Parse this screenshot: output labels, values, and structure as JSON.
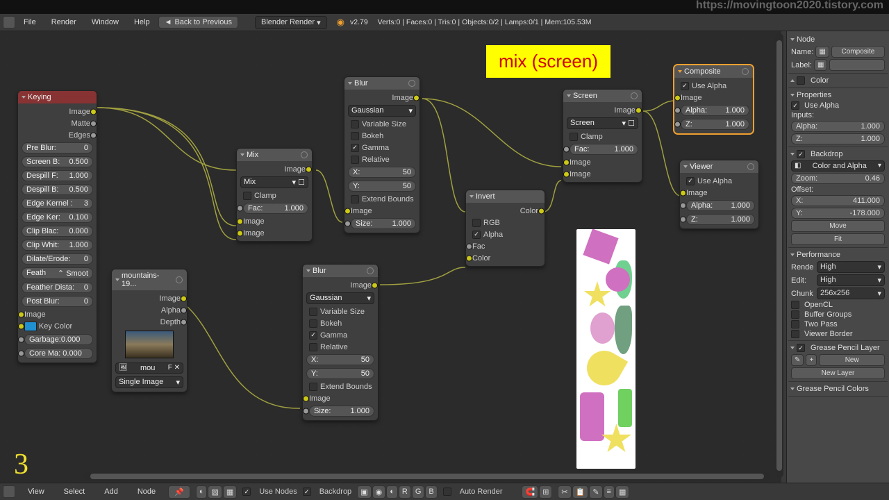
{
  "watermark": "https://movingtoon2020.tistory.com",
  "menus": {
    "file": "File",
    "render": "Render",
    "window": "Window",
    "help": "Help",
    "back": "Back to Previous",
    "engine": "Blender Render"
  },
  "version": "v2.79",
  "stats": "Verts:0 | Faces:0 | Tris:0 | Objects:0/2 | Lamps:0/1 | Mem:105.53M",
  "annot": {
    "label": "mix (screen)",
    "num": "3"
  },
  "nodes": {
    "keying": {
      "title": "Keying",
      "outs": [
        "Image",
        "Matte",
        "Edges"
      ],
      "sliders": [
        {
          "l": "Pre Blur:",
          "v": "0"
        },
        {
          "l": "Screen B:",
          "v": "0.500"
        },
        {
          "l": "Despill F:",
          "v": "1.000"
        },
        {
          "l": "Despill B:",
          "v": "0.500"
        },
        {
          "l": "Edge Kernel :",
          "v": "3"
        },
        {
          "l": "Edge Ker:",
          "v": "0.100"
        },
        {
          "l": "Clip Blac:",
          "v": "0.000"
        },
        {
          "l": "Clip Whit:",
          "v": "1.000"
        },
        {
          "l": "Dilate/Erode:",
          "v": "0"
        },
        {
          "l": "Feath",
          "v": "Smoot"
        },
        {
          "l": "Feather Dista:",
          "v": "0"
        },
        {
          "l": "Post Blur:",
          "v": "0"
        }
      ],
      "ins": [
        "Image",
        "Key Color",
        "Garbage:0.000",
        "Core Ma: 0.000"
      ]
    },
    "mountains": {
      "title": "mountains-19...",
      "outs": [
        "Image",
        "Alpha",
        "Depth"
      ],
      "file": "mou",
      "mode": "Single Image"
    },
    "mix": {
      "title": "Mix",
      "out": "Image",
      "type": "Mix",
      "clamp": "Clamp",
      "fac": {
        "l": "Fac:",
        "v": "1.000"
      },
      "ins": [
        "Image",
        "Image"
      ]
    },
    "blur1": {
      "title": "Blur",
      "out": "Image",
      "type": "Gaussian",
      "checks": [
        {
          "l": "Variable Size",
          "on": false
        },
        {
          "l": "Bokeh",
          "on": false
        },
        {
          "l": "Gamma",
          "on": true
        },
        {
          "l": "Relative",
          "on": false
        }
      ],
      "x": {
        "l": "X:",
        "v": "50"
      },
      "y": {
        "l": "Y:",
        "v": "50"
      },
      "ext": "Extend Bounds",
      "in": "Image",
      "size": {
        "l": "Size:",
        "v": "1.000"
      }
    },
    "blur2": {
      "title": "Blur",
      "out": "Image",
      "type": "Gaussian",
      "checks": [
        {
          "l": "Variable Size",
          "on": false
        },
        {
          "l": "Bokeh",
          "on": false
        },
        {
          "l": "Gamma",
          "on": true
        },
        {
          "l": "Relative",
          "on": false
        }
      ],
      "x": {
        "l": "X:",
        "v": "50"
      },
      "y": {
        "l": "Y:",
        "v": "50"
      },
      "ext": "Extend Bounds",
      "in": "Image",
      "size": {
        "l": "Size:",
        "v": "1.000"
      }
    },
    "invert": {
      "title": "Invert",
      "out": "Color",
      "rgb": "RGB",
      "alpha": "Alpha",
      "ins": [
        "Fac",
        "Color"
      ]
    },
    "screen": {
      "title": "Screen",
      "out": "Image",
      "type": "Screen",
      "clamp": "Clamp",
      "fac": {
        "l": "Fac:",
        "v": "1.000"
      },
      "ins": [
        "Image",
        "Image"
      ]
    },
    "composite": {
      "title": "Composite",
      "usealpha": "Use Alpha",
      "in": "Image",
      "alpha": {
        "l": "Alpha:",
        "v": "1.000"
      },
      "z": {
        "l": "Z:",
        "v": "1.000"
      }
    },
    "viewer": {
      "title": "Viewer",
      "usealpha": "Use Alpha",
      "in": "Image",
      "alpha": {
        "l": "Alpha:",
        "v": "1.000"
      },
      "z": {
        "l": "Z:",
        "v": "1.000"
      }
    }
  },
  "panel": {
    "node": "Node",
    "name": "Name:",
    "comp": "Composite",
    "label": "Label:",
    "color": "Color",
    "props": "Properties",
    "usealpha": "Use Alpha",
    "inputs": "Inputs:",
    "alpha": {
      "l": "Alpha:",
      "v": "1.000"
    },
    "z": {
      "l": "Z:",
      "v": "1.000"
    },
    "backdrop": "Backdrop",
    "colormode": "Color and Alpha",
    "zoom": {
      "l": "Zoom:",
      "v": "0.46"
    },
    "offset": "Offset:",
    "x": {
      "l": "X:",
      "v": "411.000"
    },
    "y": {
      "l": "Y:",
      "v": "-178.000"
    },
    "move": "Move",
    "fit": "Fit",
    "perf": "Performance",
    "render": "Rende",
    "edit": "Edit:",
    "high": "High",
    "chunk": "Chunk",
    "chunkv": "256x256",
    "opencl": "OpenCL",
    "buffer": "Buffer Groups",
    "twopass": "Two Pass",
    "viewer": "Viewer Border",
    "gp": "Grease Pencil Layer",
    "new": "New",
    "newlayer": "New Layer",
    "gpc": "Grease Pencil Colors"
  },
  "bottom": {
    "view": "View",
    "select": "Select",
    "add": "Add",
    "node": "Node",
    "usenodes": "Use Nodes",
    "backdrop": "Backdrop",
    "autorender": "Auto Render"
  }
}
